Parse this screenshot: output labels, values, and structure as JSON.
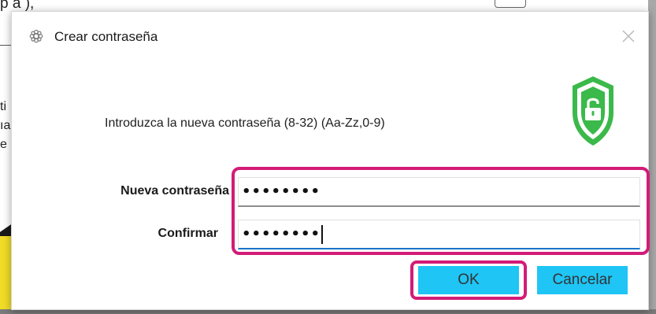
{
  "background": {
    "top_text": "p a ),",
    "side_letters": [
      "ti",
      "ıa",
      "e"
    ]
  },
  "dialog": {
    "title": "Crear contraseña",
    "icons": {
      "app": "gear-flower-icon",
      "close": "close-icon",
      "shield": "shield-unlocked-icon"
    },
    "prompt": "Introduzca la nueva contraseña (8-32) (Aa-Zz,0-9)",
    "fields": {
      "new_password": {
        "label": "Nueva contraseña",
        "value": "••••••••"
      },
      "confirm": {
        "label": "Confirmar",
        "value": "••••••••"
      }
    },
    "buttons": {
      "ok": "OK",
      "cancel": "Cancelar"
    }
  },
  "colors": {
    "button_bg": "#1ec5f5",
    "highlight": "#d31b77",
    "shield_green": "#3bb94a"
  }
}
